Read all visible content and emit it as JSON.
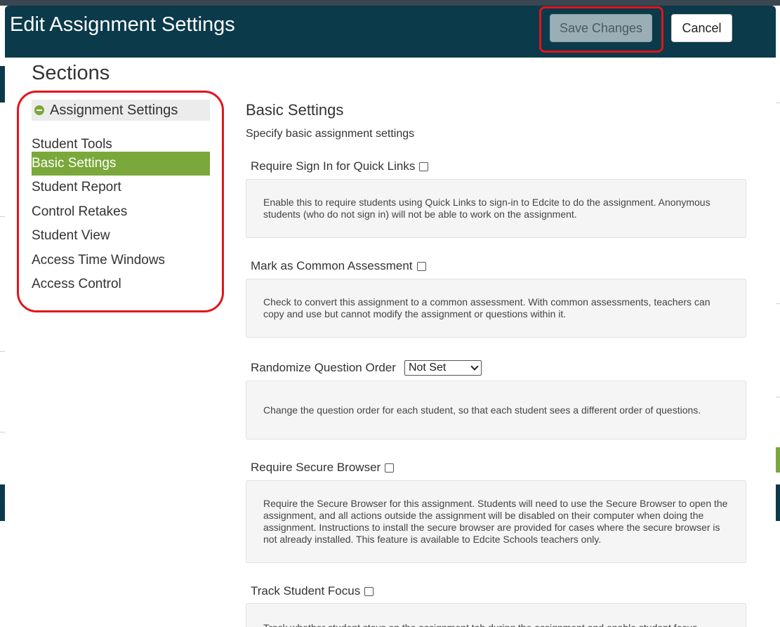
{
  "modal": {
    "title": "Edit Assignment Settings",
    "save_label": "Save Changes",
    "cancel_label": "Cancel"
  },
  "sidebar": {
    "title": "Sections",
    "group_label": "Assignment Settings",
    "items": [
      {
        "label": "Student Tools",
        "active": false
      },
      {
        "label": "Basic Settings",
        "active": true
      },
      {
        "label": "Student Report",
        "active": false
      },
      {
        "label": "Control Retakes",
        "active": false
      },
      {
        "label": "Student View",
        "active": false
      },
      {
        "label": "Access Time Windows",
        "active": false
      },
      {
        "label": "Access Control",
        "active": false
      }
    ]
  },
  "content": {
    "title": "Basic Settings",
    "subtitle": "Specify basic assignment settings",
    "settings": [
      {
        "label": "Require Sign In for Quick Links",
        "control": "checkbox",
        "checked": false,
        "description": "Enable this to require students using Quick Links to sign-in to Edcite to do the assignment. Anonymous students (who do not sign in) will not be able to work on the assignment."
      },
      {
        "label": "Mark as Common Assessment",
        "control": "checkbox",
        "checked": false,
        "description": "Check to convert this assignment to a common assessment. With common assessments, teachers can copy and use but cannot modify the assignment or questions within it."
      },
      {
        "label": "Randomize Question Order",
        "control": "select",
        "selected": "Not Set",
        "description": "Change the question order for each student, so that each student sees a different order of questions."
      },
      {
        "label": "Require Secure Browser",
        "control": "checkbox",
        "checked": false,
        "description": "Require the Secure Browser for this assignment. Students will need to use the Secure Browser to open the assignment, and all actions outside the assignment will be disabled on their computer when doing the assignment. Instructions to install the secure browser are provided for cases where the secure browser is not already installed. This feature is available to Edcite Schools teachers only."
      },
      {
        "label": "Track Student Focus",
        "control": "checkbox",
        "checked": false,
        "description": "Track whether student stays on the assignment tab during the assignment and enable student focus"
      }
    ]
  },
  "colors": {
    "header": "#0b3a4a",
    "accent_green": "#7aa83a",
    "highlight_red": "#e3141b"
  }
}
